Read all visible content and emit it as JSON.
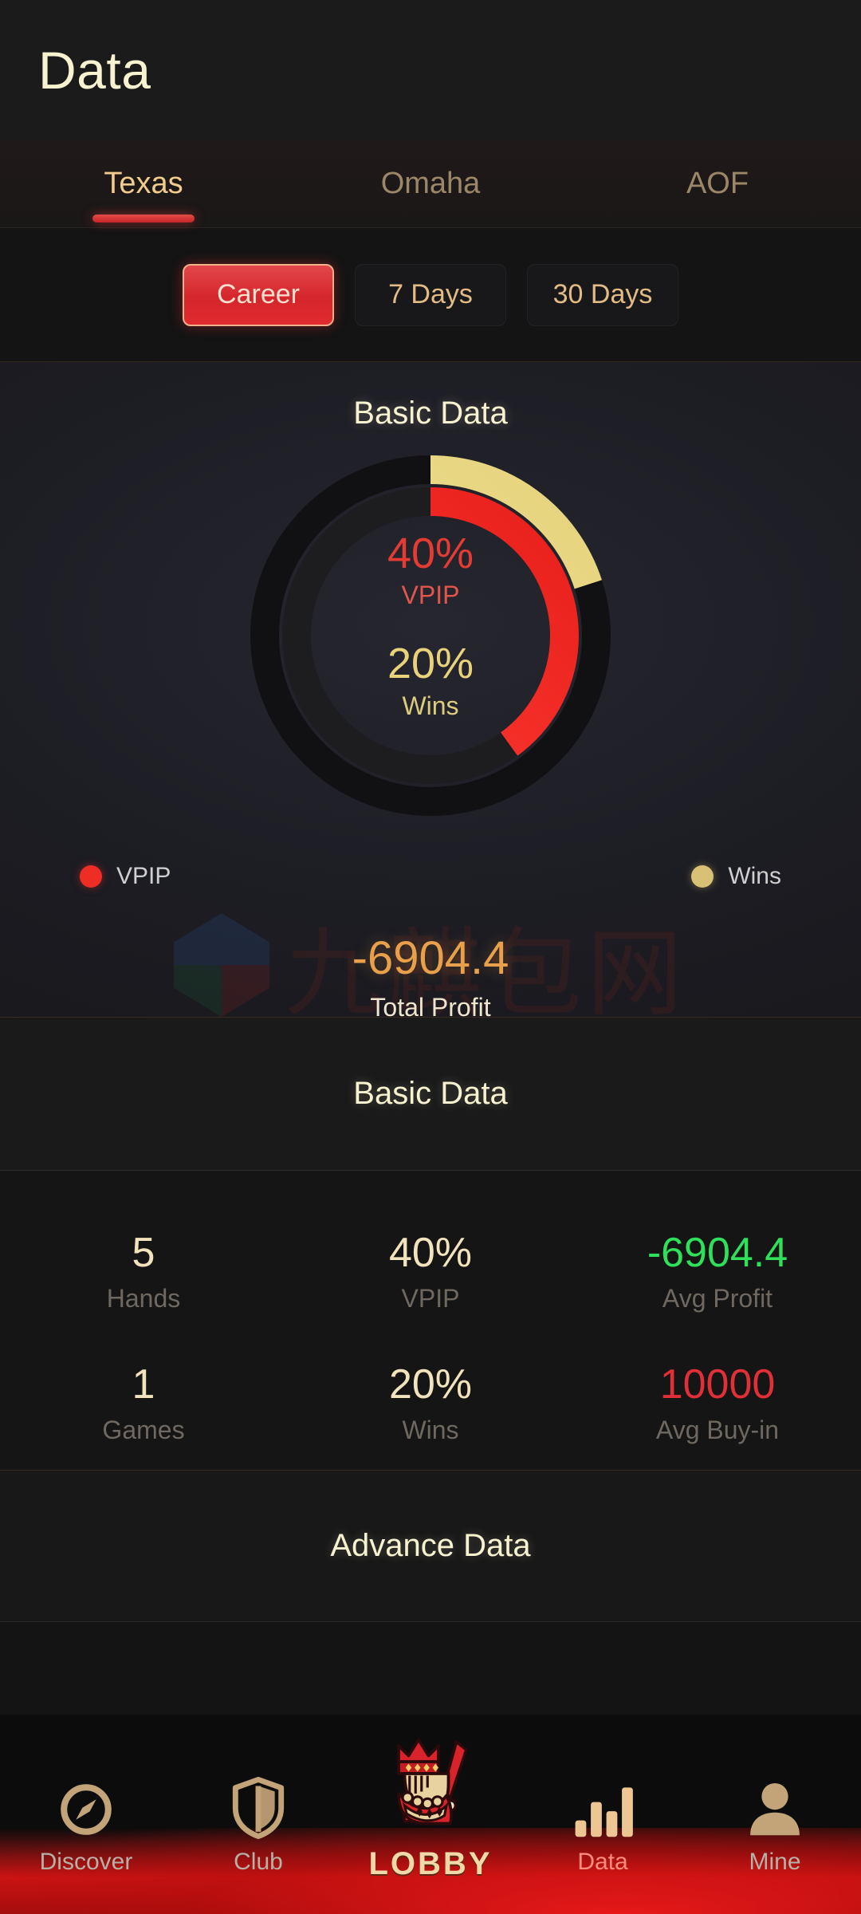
{
  "header": {
    "title": "Data"
  },
  "tabs": [
    {
      "label": "Texas",
      "active": true
    },
    {
      "label": "Omaha",
      "active": false
    },
    {
      "label": "AOF",
      "active": false
    }
  ],
  "periods": [
    {
      "label": "Career",
      "active": true
    },
    {
      "label": "7 Days",
      "active": false
    },
    {
      "label": "30 Days",
      "active": false
    }
  ],
  "chart_section": {
    "title": "Basic Data",
    "center": {
      "vpip_value": "40%",
      "vpip_label": "VPIP",
      "wins_value": "20%",
      "wins_label": "Wins"
    },
    "legend": [
      {
        "label": "VPIP",
        "color": "#ee2d24"
      },
      {
        "label": "Wins",
        "color": "#d8c074"
      }
    ],
    "total_profit": {
      "value": "-6904.4",
      "label": "Total Profit"
    },
    "watermark": "九麒包网"
  },
  "chart_data": {
    "type": "pie",
    "title": "Basic Data",
    "subtype": "concentric-donut-gauge",
    "start_angle_deg": 0,
    "direction": "clockwise",
    "rings": [
      {
        "name": "Wins",
        "position": "outer",
        "value": 20,
        "max": 100,
        "unit": "%",
        "color": "#ecdd8b",
        "track_color": "#1a1a1a"
      },
      {
        "name": "VPIP",
        "position": "inner",
        "value": 40,
        "max": 100,
        "unit": "%",
        "color": "#f02b27",
        "track_color": "#1f1f1f"
      }
    ],
    "legend": [
      "VPIP",
      "Wins"
    ],
    "legend_position": "below",
    "annotations": [
      {
        "text": "40%",
        "series": "VPIP",
        "color": "#e43b33"
      },
      {
        "text": "VPIP",
        "series": "VPIP",
        "color": "#e0564b"
      },
      {
        "text": "20%",
        "series": "Wins",
        "color": "#e8d27a"
      },
      {
        "text": "Wins",
        "series": "Wins",
        "color": "#ddcb7e"
      },
      {
        "text": "-6904.4",
        "series": "Total Profit",
        "color": "#e8a14a"
      },
      {
        "text": "Total Profit",
        "series": "Total Profit",
        "color": "#efe6cd"
      }
    ]
  },
  "basic_data": {
    "title": "Basic Data",
    "stats": [
      {
        "value": "5",
        "label": "Hands",
        "color": "#f1e3bb"
      },
      {
        "value": "40%",
        "label": "VPIP",
        "color": "#f1e3bb"
      },
      {
        "value": "-6904.4",
        "label": "Avg Profit",
        "color": "#2fe05a"
      },
      {
        "value": "1",
        "label": "Games",
        "color": "#f1e3bb"
      },
      {
        "value": "20%",
        "label": "Wins",
        "color": "#f1e3bb"
      },
      {
        "value": "10000",
        "label": "Avg Buy-in",
        "color": "#e02f37"
      }
    ]
  },
  "advance_data": {
    "title": "Advance Data"
  },
  "bottom_nav": [
    {
      "label": "Discover",
      "icon": "compass-icon",
      "active": false
    },
    {
      "label": "Club",
      "icon": "shield-icon",
      "active": false
    },
    {
      "label": "LOBBY",
      "icon": "king-mascot-icon",
      "active": false
    },
    {
      "label": "Data",
      "icon": "bar-chart-icon",
      "active": true
    },
    {
      "label": "Mine",
      "icon": "person-icon",
      "active": false
    }
  ],
  "colors": {
    "accent_red": "#d4262c",
    "accent_gold": "#f2cc8c",
    "cream": "#f7f2cf",
    "positive_green": "#2fe05a",
    "negative_red": "#e02f37",
    "profit_orange": "#e8a14a"
  }
}
